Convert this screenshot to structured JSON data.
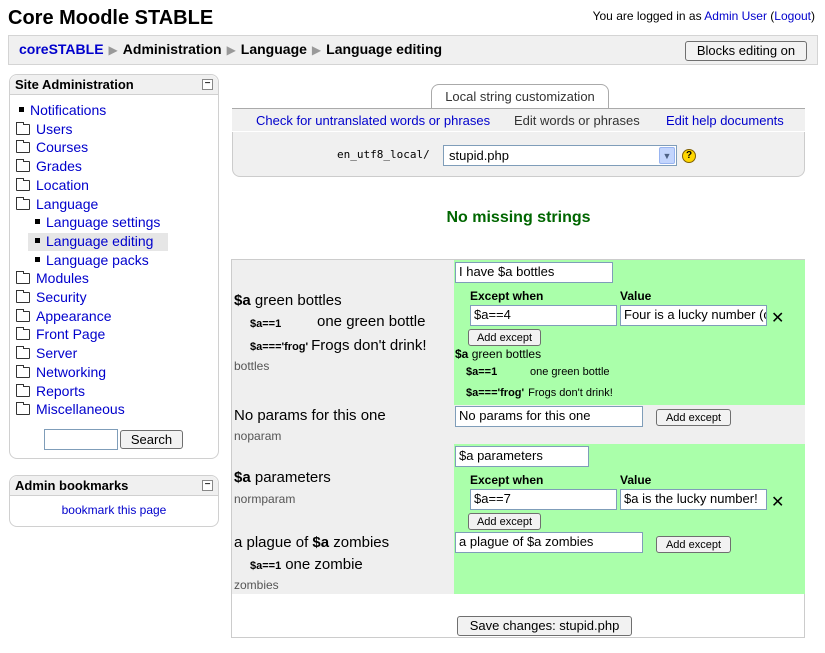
{
  "header": {
    "site_title": "Core Moodle STABLE",
    "logged_in_prefix": "You are logged in as ",
    "user_name": "Admin User",
    "logout_label": "Logout"
  },
  "breadcrumb": {
    "items": [
      "coreSTABLE",
      "Administration",
      "Language",
      "Language editing"
    ],
    "separator": "▶"
  },
  "blocks_editing_button": "Blocks editing on",
  "site_admin": {
    "title": "Site Administration",
    "items": [
      {
        "label": "Notifications",
        "icon": "bullet"
      },
      {
        "label": "Users",
        "icon": "folder"
      },
      {
        "label": "Courses",
        "icon": "folder"
      },
      {
        "label": "Grades",
        "icon": "folder"
      },
      {
        "label": "Location",
        "icon": "folder"
      },
      {
        "label": "Language",
        "icon": "folder-open"
      },
      {
        "label": "Language settings",
        "icon": "bullet"
      },
      {
        "label": "Language editing",
        "icon": "bullet"
      },
      {
        "label": "Language packs",
        "icon": "bullet"
      },
      {
        "label": "Modules",
        "icon": "folder"
      },
      {
        "label": "Security",
        "icon": "folder"
      },
      {
        "label": "Appearance",
        "icon": "folder"
      },
      {
        "label": "Front Page",
        "icon": "folder"
      },
      {
        "label": "Server",
        "icon": "folder"
      },
      {
        "label": "Networking",
        "icon": "folder"
      },
      {
        "label": "Reports",
        "icon": "folder"
      },
      {
        "label": "Miscellaneous",
        "icon": "folder"
      }
    ],
    "search_placeholder": "",
    "search_button": "Search"
  },
  "bookmarks": {
    "title": "Admin bookmarks",
    "link": "bookmark this page"
  },
  "tabs": {
    "main": "Local string customization",
    "sub": [
      "Check for untranslated words or phrases",
      "Edit words or phrases",
      "Edit help documents"
    ]
  },
  "file_select": {
    "prefix": "en_utf8_local/",
    "value": "stupid.php"
  },
  "status_message": "No missing strings",
  "strings": [
    {
      "key": "bottles",
      "original_var": "$a",
      "original_rest": " green bottles",
      "original_excepts": [
        {
          "cond": "$a==1",
          "text": "one green bottle"
        },
        {
          "cond": "$a==='frog'",
          "text": "Frogs don't drink!"
        }
      ],
      "value": "I have $a bottles",
      "except_header": "Except when",
      "value_header": "Value",
      "except_rows": [
        {
          "cond": "$a==4",
          "val": "Four is a lucky number (o"
        }
      ],
      "add_except": "Add except",
      "preview_var": "$a",
      "preview_rest": " green bottles",
      "preview_excepts": [
        {
          "cond": "$a==1",
          "text": "one green bottle"
        },
        {
          "cond": "$a==='frog'",
          "text": "Frogs don't drink!"
        }
      ]
    },
    {
      "key": "noparam",
      "original_text": "No params for this one",
      "value": "No params for this one",
      "add_except": "Add except"
    },
    {
      "key": "normparam",
      "original_var": "$a",
      "original_rest": " parameters",
      "value": "$a parameters",
      "except_header": "Except when",
      "value_header": "Value",
      "except_rows": [
        {
          "cond": "$a==7",
          "val": "$a is the lucky number!"
        }
      ],
      "add_except": "Add except"
    },
    {
      "key": "zombies",
      "original_pre": "a plague of ",
      "original_var": "$a",
      "original_rest": " zombies",
      "original_excepts": [
        {
          "cond": "$a==1",
          "text": "one zombie"
        }
      ],
      "value": "a plague of $a zombies",
      "add_except": "Add except"
    }
  ],
  "save_button": "Save changes: stupid.php",
  "colors": {
    "green_cell": "#aaffaa",
    "grey_cell": "#efefef",
    "status_green": "#006600",
    "link": "#0000cc"
  }
}
